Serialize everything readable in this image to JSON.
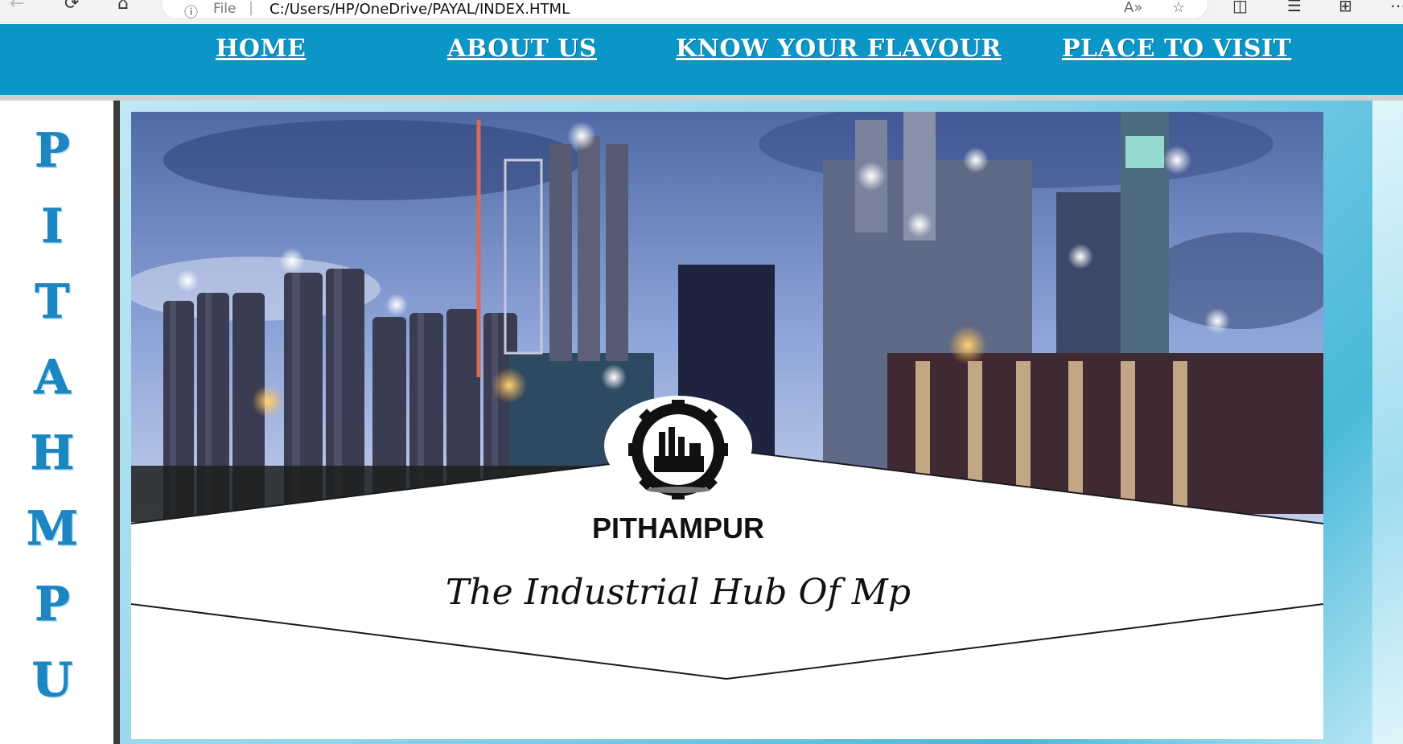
{
  "browser": {
    "file_label": "File",
    "url": "C:/Users/HP/OneDrive/PAYAL/INDEX.HTML"
  },
  "nav": {
    "items": [
      {
        "label": "HOME"
      },
      {
        "label": "ABOUT US"
      },
      {
        "label": "KNOW YOUR FLAVOUR"
      },
      {
        "label": "PLACE TO VISIT"
      }
    ]
  },
  "side_title": {
    "letters": [
      "P",
      "I",
      "T",
      "A",
      "H",
      "M",
      "P",
      "U"
    ]
  },
  "banner": {
    "title": "PITHAMPUR",
    "tagline": "The Industrial Hub Of Mp"
  },
  "colors": {
    "nav_bg": "#0a96c6",
    "side_letter": "#1c86c2",
    "accent_light": "#8fd3ea"
  }
}
